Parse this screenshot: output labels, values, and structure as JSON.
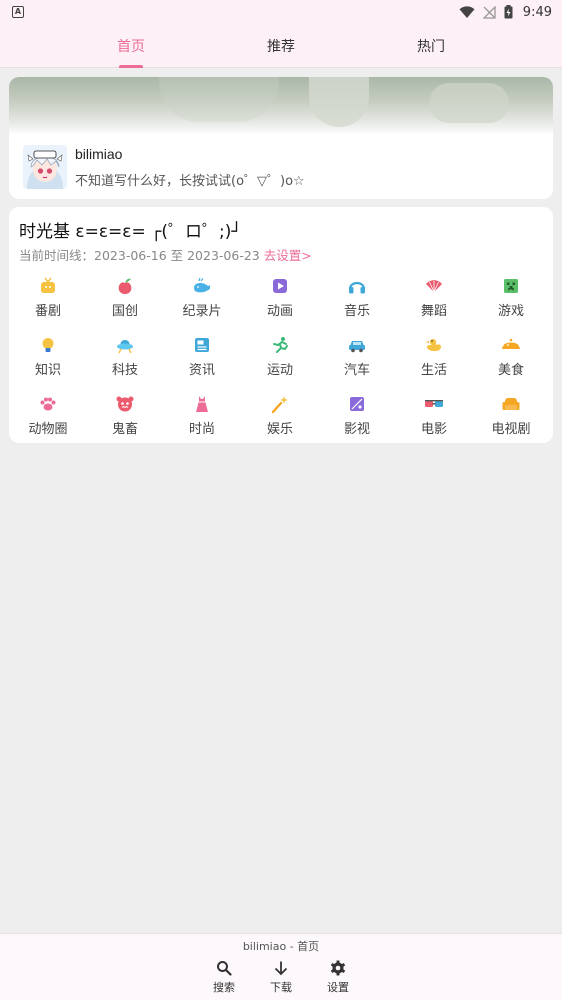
{
  "status_bar": {
    "app_indicator": "A",
    "time": "9:49"
  },
  "tabs": [
    {
      "label": "首页",
      "active": true
    },
    {
      "label": "推荐",
      "active": false
    },
    {
      "label": "热门",
      "active": false
    }
  ],
  "profile": {
    "username": "bilimiao",
    "signature": "不知道写什么好，长按试试(o゜▽゜)o☆"
  },
  "time_machine": {
    "title": "时光基  ε=ε=ε= ┌(゜ロ゜;)┘",
    "range_label": "当前时间线：",
    "range_value": "2023-06-16 至 2023-06-23",
    "set_link": "去设置>"
  },
  "categories": [
    {
      "label": "番剧",
      "icon": "tv-icon",
      "color": "#f5c242"
    },
    {
      "label": "国创",
      "icon": "peach-icon",
      "color": "#ec5a6e"
    },
    {
      "label": "纪录片",
      "icon": "whale-icon",
      "color": "#4ab1e6"
    },
    {
      "label": "动画",
      "icon": "play-icon",
      "color": "#8a6ad8"
    },
    {
      "label": "音乐",
      "icon": "headphones-icon",
      "color": "#3fa8d8"
    },
    {
      "label": "舞蹈",
      "icon": "fan-icon",
      "color": "#ec5a6e"
    },
    {
      "label": "游戏",
      "icon": "creeper-icon",
      "color": "#5bbf6a"
    },
    {
      "label": "知识",
      "icon": "lightbulb-icon",
      "color": "#f5c242"
    },
    {
      "label": "科技",
      "icon": "ufo-icon",
      "color": "#3fa8d8"
    },
    {
      "label": "资讯",
      "icon": "news-icon",
      "color": "#3fa8d8"
    },
    {
      "label": "运动",
      "icon": "runner-icon",
      "color": "#3cb878"
    },
    {
      "label": "汽车",
      "icon": "car-icon",
      "color": "#3fa8d8"
    },
    {
      "label": "生活",
      "icon": "duck-icon",
      "color": "#f5c242"
    },
    {
      "label": "美食",
      "icon": "dish-icon",
      "color": "#f5a623"
    },
    {
      "label": "动物圈",
      "icon": "paw-icon",
      "color": "#ec6c96"
    },
    {
      "label": "鬼畜",
      "icon": "monster-icon",
      "color": "#ec5a6e"
    },
    {
      "label": "时尚",
      "icon": "dress-icon",
      "color": "#ec6c96"
    },
    {
      "label": "娱乐",
      "icon": "wand-icon",
      "color": "#f5a623"
    },
    {
      "label": "影视",
      "icon": "film-icon",
      "color": "#8a6ad8"
    },
    {
      "label": "电影",
      "icon": "3d-glasses-icon",
      "color": "#ec5a6e"
    },
    {
      "label": "电视剧",
      "icon": "sofa-icon",
      "color": "#f5a623"
    }
  ],
  "bottom_bar": {
    "title": "bilimiao - 首页",
    "search_label": "搜索",
    "download_label": "下载",
    "settings_label": "设置"
  },
  "colors": {
    "accent": "#ec6c96",
    "header_bg": "#fdf1f7",
    "page_bg": "#eeeeee"
  }
}
